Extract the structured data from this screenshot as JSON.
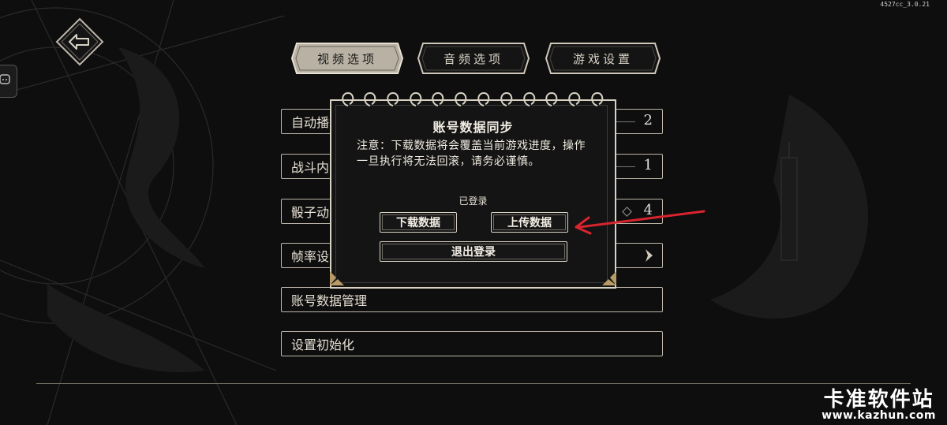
{
  "version": "4527cc_3.0.21",
  "tabs": [
    {
      "label": "视频选项",
      "active": true
    },
    {
      "label": "音频选项",
      "active": false
    },
    {
      "label": "游戏设置",
      "active": false
    }
  ],
  "settings_rows": [
    {
      "label": "自动播",
      "value": "2"
    },
    {
      "label": "战斗内",
      "value": "1"
    },
    {
      "label": "骰子动",
      "value": "4"
    },
    {
      "label": "帧率设",
      "value": ""
    },
    {
      "label": "账号数据管理",
      "value": ""
    },
    {
      "label": "设置初始化",
      "value": ""
    }
  ],
  "dialog": {
    "title": "账号数据同步",
    "notice": "注意：下载数据将会覆盖当前游戏进度，操作一旦执行将无法回滚，请务必谨慎。",
    "status": "已登录",
    "download_label": "下载数据",
    "upload_label": "上传数据",
    "logout_label": "退出登录"
  },
  "watermark": {
    "name": "卡准软件站",
    "url": "www.kazhun.com"
  },
  "colors": {
    "background": "#0e0e0e",
    "frame": "#d8d2c4",
    "annotation_arrow": "#d8242f"
  },
  "icons": {
    "back": "back-arrow-icon",
    "side": "chat-bubble-icon",
    "row_more": "chevron-right-icon"
  }
}
